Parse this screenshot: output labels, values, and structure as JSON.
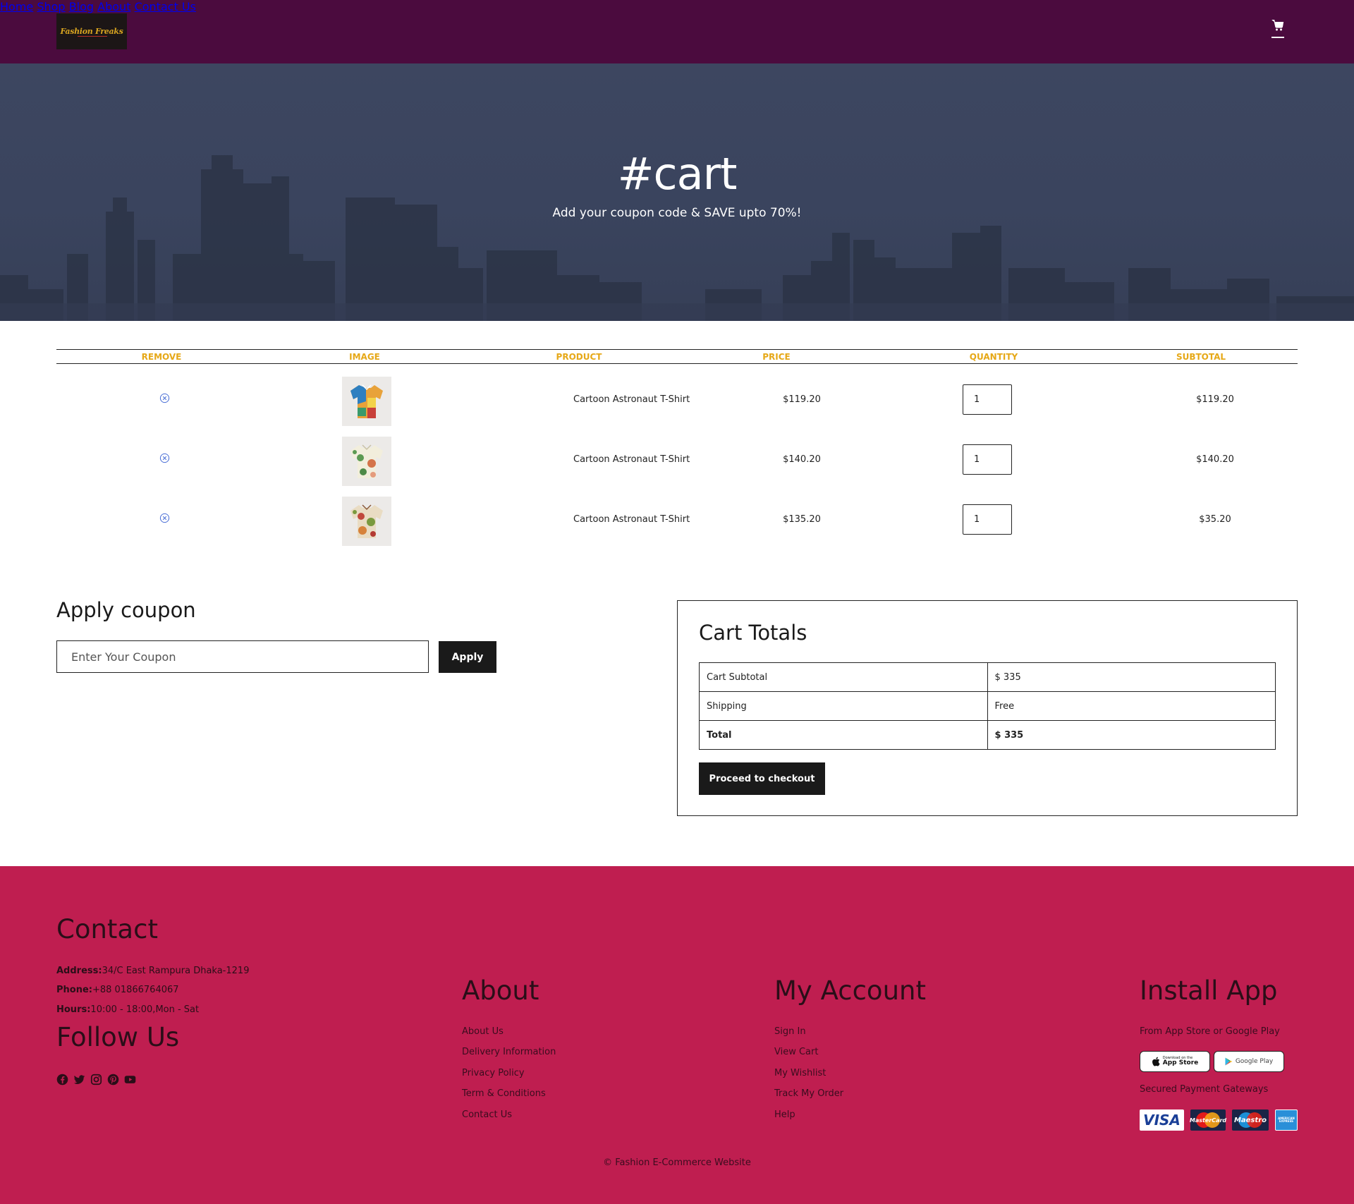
{
  "header": {
    "logo_text": "Fashion Freaks",
    "nav": [
      {
        "label": "Home"
      },
      {
        "label": "Shop"
      },
      {
        "label": "Blog"
      },
      {
        "label": "About"
      },
      {
        "label": "Contact Us"
      }
    ]
  },
  "hero": {
    "title": "#cart",
    "subtitle": "Add your coupon code & SAVE upto 70%!"
  },
  "cart": {
    "columns": [
      "REMOVE",
      "IMAGE",
      "PRODUCT",
      "PRICE",
      "QUANTITY",
      "SUBTOTAL"
    ],
    "rows": [
      {
        "product": "Cartoon Astronaut T-Shirt",
        "price": "$119.20",
        "quantity": "1",
        "subtotal": "$119.20"
      },
      {
        "product": "Cartoon Astronaut T-Shirt",
        "price": "$140.20",
        "quantity": "1",
        "subtotal": "$140.20"
      },
      {
        "product": "Cartoon Astronaut T-Shirt",
        "price": "$135.20",
        "quantity": "1",
        "subtotal": "$35.20"
      }
    ]
  },
  "coupon": {
    "title": "Apply coupon",
    "placeholder": "Enter Your Coupon",
    "button": "Apply"
  },
  "totals": {
    "title": "Cart Totals",
    "rows": [
      {
        "label": "Cart Subtotal",
        "value": "$ 335"
      },
      {
        "label": "Shipping",
        "value": "Free"
      },
      {
        "label": "Total",
        "value": "$ 335"
      }
    ],
    "checkout_button": "Proceed to checkout"
  },
  "footer": {
    "contact": {
      "title": "Contact",
      "address_label": "Address:",
      "address": "34/C East Rampura Dhaka-1219",
      "phone_label": "Phone:",
      "phone": "+88 01866764067",
      "hours_label": "Hours:",
      "hours": "10:00 - 18:00,Mon - Sat"
    },
    "follow": {
      "title": "Follow Us",
      "icons": [
        "facebook-icon",
        "twitter-icon",
        "instagram-icon",
        "pinterest-icon",
        "youtube-icon"
      ]
    },
    "about": {
      "title": "About",
      "links": [
        "About Us",
        "Delivery Information",
        "Privacy Policy",
        "Term & Conditions",
        "Contact Us"
      ]
    },
    "account": {
      "title": "My Account",
      "links": [
        "Sign In",
        "View Cart",
        "My Wishlist",
        "Track My Order",
        "Help"
      ]
    },
    "install": {
      "title": "Install App",
      "subtitle": "From App Store or Google Play",
      "app_store_small": "Download on the",
      "app_store": "App Store",
      "google_play": "Google Play",
      "payments_title": "Secured Payment Gateways",
      "payments": [
        "VISA",
        "MasterCard",
        "Maestro",
        "AMERICAN EXPRESS"
      ]
    },
    "copyright": "© Fashion E-Commerce Website"
  },
  "colors": {
    "header_bg": "#4b0b3e",
    "accent_heading": "#e6a817",
    "footer_bg": "#bf1e50",
    "button_dark": "#1a1a1a"
  }
}
